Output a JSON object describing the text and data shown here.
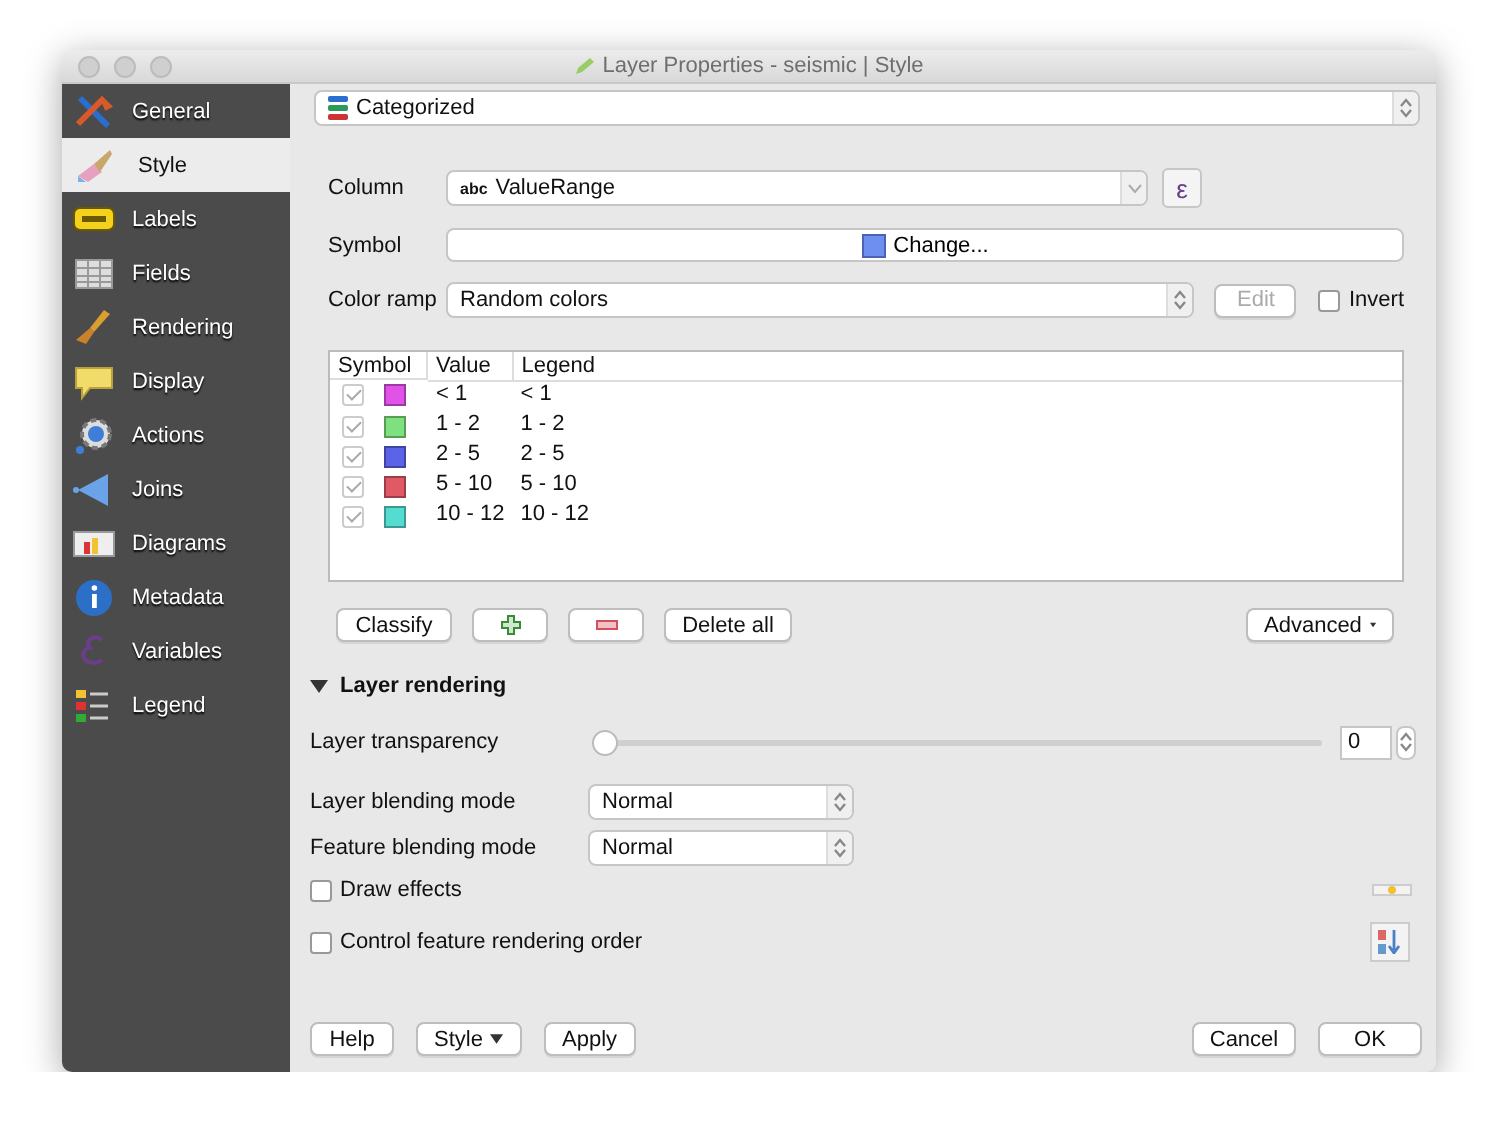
{
  "window": {
    "title": "Layer Properties - seismic | Style"
  },
  "sidebar": {
    "items": [
      {
        "label": "General",
        "selected": false
      },
      {
        "label": "Style",
        "selected": true
      },
      {
        "label": "Labels",
        "selected": false
      },
      {
        "label": "Fields",
        "selected": false
      },
      {
        "label": "Rendering",
        "selected": false
      },
      {
        "label": "Display",
        "selected": false
      },
      {
        "label": "Actions",
        "selected": false
      },
      {
        "label": "Joins",
        "selected": false
      },
      {
        "label": "Diagrams",
        "selected": false
      },
      {
        "label": "Metadata",
        "selected": false
      },
      {
        "label": "Variables",
        "selected": false
      },
      {
        "label": "Legend",
        "selected": false
      }
    ]
  },
  "renderer": {
    "value": "Categorized"
  },
  "column": {
    "label": "Column",
    "type_tag": "abc",
    "value": "ValueRange",
    "expression_button": "ε"
  },
  "symbol": {
    "label": "Symbol",
    "button": "Change..."
  },
  "color_ramp": {
    "label": "Color ramp",
    "value": "Random colors",
    "edit_button": "Edit",
    "edit_disabled": true,
    "invert": {
      "label": "Invert",
      "checked": false
    }
  },
  "categories": {
    "columns": [
      "Symbol",
      "Value",
      "Legend"
    ],
    "rows": [
      {
        "checked": true,
        "color": "#e052e8",
        "value": "< 1",
        "legend": "< 1"
      },
      {
        "checked": true,
        "color": "#7ee07e",
        "value": "1 - 2",
        "legend": "1 - 2"
      },
      {
        "checked": true,
        "color": "#5b63e6",
        "value": "2 - 5",
        "legend": "2 - 5"
      },
      {
        "checked": true,
        "color": "#e05a66",
        "value": "5 - 10",
        "legend": "5 - 10"
      },
      {
        "checked": true,
        "color": "#55dcd0",
        "value": "10 - 12",
        "legend": "10 - 12"
      }
    ]
  },
  "category_buttons": {
    "classify": "Classify",
    "delete_all": "Delete all",
    "advanced": "Advanced"
  },
  "layer_rendering": {
    "title": "Layer rendering",
    "expanded": true,
    "transparency": {
      "label": "Layer transparency",
      "level": 0,
      "value": "0"
    },
    "layer_blending": {
      "label": "Layer blending mode",
      "value": "Normal"
    },
    "feature_blending": {
      "label": "Feature blending mode",
      "value": "Normal"
    },
    "draw_effects": {
      "label": "Draw effects",
      "checked": false
    },
    "rendering_order": {
      "label": "Control feature rendering order",
      "checked": false
    }
  },
  "footer": {
    "left": [
      {
        "label": "Help",
        "kind": "plain"
      },
      {
        "label": "Style",
        "kind": "menu"
      },
      {
        "label": "Apply",
        "kind": "plain"
      }
    ],
    "right": [
      {
        "label": "Cancel",
        "kind": "plain"
      },
      {
        "label": "OK",
        "kind": "plain"
      }
    ]
  }
}
